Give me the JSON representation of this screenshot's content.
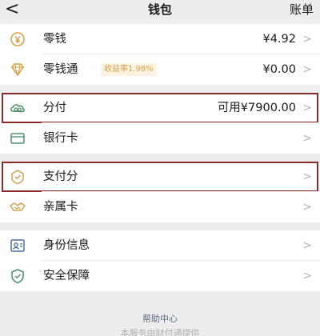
{
  "nav": {
    "back_icon": "chevron-left-icon",
    "title": "钱包",
    "right_label": "账单"
  },
  "groups": [
    {
      "items": [
        {
          "key": "change",
          "icon": "yen-coin-icon",
          "label": "零钱",
          "value": "¥4.92"
        },
        {
          "key": "lct",
          "icon": "diamond-icon",
          "label": "零钱通",
          "badge": "收益率1.98%",
          "value": "¥0.00"
        }
      ]
    },
    {
      "items": [
        {
          "key": "fenfu",
          "icon": "cloud-pay-icon",
          "label": "分付",
          "value": "可用¥7900.00",
          "highlighted": true
        },
        {
          "key": "bankcard",
          "icon": "card-icon",
          "label": "银行卡",
          "value": ""
        }
      ]
    },
    {
      "items": [
        {
          "key": "payscore",
          "icon": "score-badge-icon",
          "label": "支付分",
          "value": "",
          "highlighted": true
        },
        {
          "key": "family",
          "icon": "handshake-card-icon",
          "label": "亲属卡",
          "value": ""
        }
      ]
    },
    {
      "items": [
        {
          "key": "identity",
          "icon": "id-card-icon",
          "label": "身份信息",
          "value": ""
        },
        {
          "key": "security",
          "icon": "shield-icon",
          "label": "安全保障",
          "value": ""
        }
      ]
    }
  ],
  "chevron": ">",
  "footer": {
    "help": "帮助中心",
    "sub": "本服务由财付通提供"
  },
  "colors": {
    "accent_gold": "#d4a24c",
    "icon_green": "#4a8f6a",
    "highlight_box": "#8b2a2a",
    "link_blue": "#5d6b84"
  }
}
